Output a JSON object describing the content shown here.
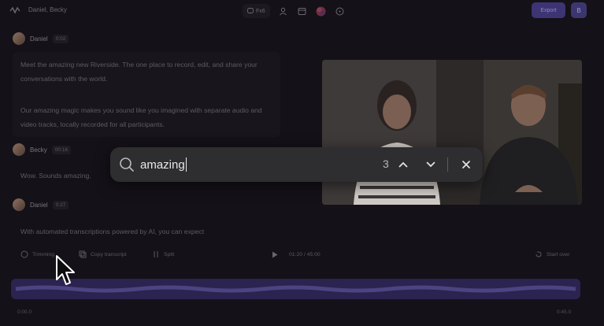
{
  "header": {
    "project_title": "Daniel, Becky",
    "pill_label": "Fx6",
    "export_label": "Export",
    "avatar_initial": "B"
  },
  "transcript": {
    "blocks": [
      {
        "speaker": "Daniel",
        "time": "0:02",
        "paragraphs": [
          "Meet the amazing new Riverside. The one place to record, edit, and share your conversations with the world.",
          "Our amazing magic makes you sound like you imagined with separate audio and video tracks, locally recorded for all participants."
        ]
      },
      {
        "speaker": "Becky",
        "time": "00:16",
        "paragraphs": [
          "Wow. Sounds amazing."
        ]
      },
      {
        "speaker": "Daniel",
        "time": "0:27",
        "paragraphs": [
          "With automated transcriptions powered by AI, you can expect"
        ]
      }
    ]
  },
  "toolbar": {
    "tool1_label": "Trimming",
    "copy_label": "Copy transcript",
    "split_label": "Split",
    "time_display": "01:20 / 45:00",
    "start_over_label": "Start over"
  },
  "timeline": {
    "start": "0:00.0",
    "end": "0:45.0"
  },
  "search": {
    "query": "amazing",
    "match_count": "3"
  },
  "colors": {
    "accent": "#3d3473",
    "overlay": "#2e2d30"
  }
}
